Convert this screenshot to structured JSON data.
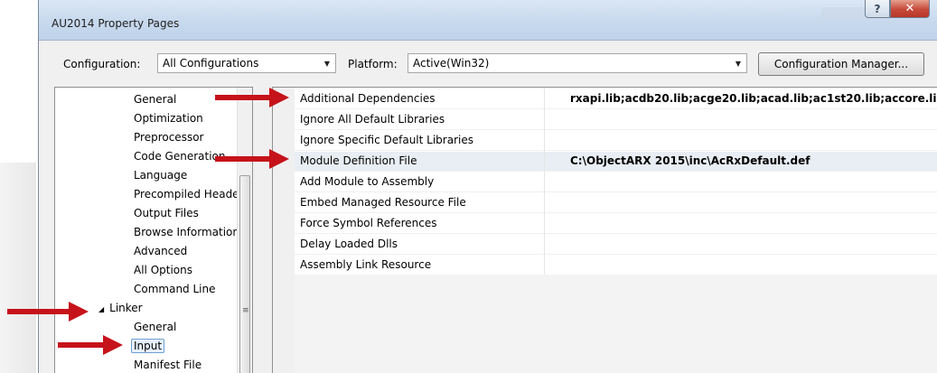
{
  "window": {
    "title": "AU2014 Property Pages",
    "help_glyph": "?",
    "close_glyph": "✕"
  },
  "config_bar": {
    "configuration_label": "Configuration:",
    "configuration_value": "All Configurations",
    "platform_label": "Platform:",
    "platform_value": "Active(Win32)",
    "config_manager_label": "Configuration Manager...",
    "dropdown_glyph": "▼"
  },
  "tree": {
    "items": [
      {
        "label": "General"
      },
      {
        "label": "Optimization"
      },
      {
        "label": "Preprocessor"
      },
      {
        "label": "Code Generation"
      },
      {
        "label": "Language"
      },
      {
        "label": "Precompiled Header"
      },
      {
        "label": "Output Files"
      },
      {
        "label": "Browse Information"
      },
      {
        "label": "Advanced"
      },
      {
        "label": "All Options"
      },
      {
        "label": "Command Line"
      },
      {
        "label": "Linker",
        "expand_glyph": "◢"
      },
      {
        "label": "General"
      },
      {
        "label": "Input"
      },
      {
        "label": "Manifest File"
      }
    ],
    "scroll_grip": "≡"
  },
  "properties": {
    "rows": [
      {
        "name": "Additional Dependencies",
        "value": "rxapi.lib;acdb20.lib;acge20.lib;acad.lib;ac1st20.lib;accore.lib;%(Ad"
      },
      {
        "name": "Ignore All Default Libraries",
        "value": ""
      },
      {
        "name": "Ignore Specific Default Libraries",
        "value": ""
      },
      {
        "name": "Module Definition File",
        "value": "C:\\ObjectARX 2015\\inc\\AcRxDefault.def"
      },
      {
        "name": "Add Module to Assembly",
        "value": ""
      },
      {
        "name": "Embed Managed Resource File",
        "value": ""
      },
      {
        "name": "Force Symbol References",
        "value": ""
      },
      {
        "name": "Delay Loaded Dlls",
        "value": ""
      },
      {
        "name": "Assembly Link Resource",
        "value": ""
      }
    ]
  },
  "colors": {
    "annotation_arrow": "#c6121a",
    "selection_border": "#6f9ed6",
    "close_button": "#c6493a"
  }
}
